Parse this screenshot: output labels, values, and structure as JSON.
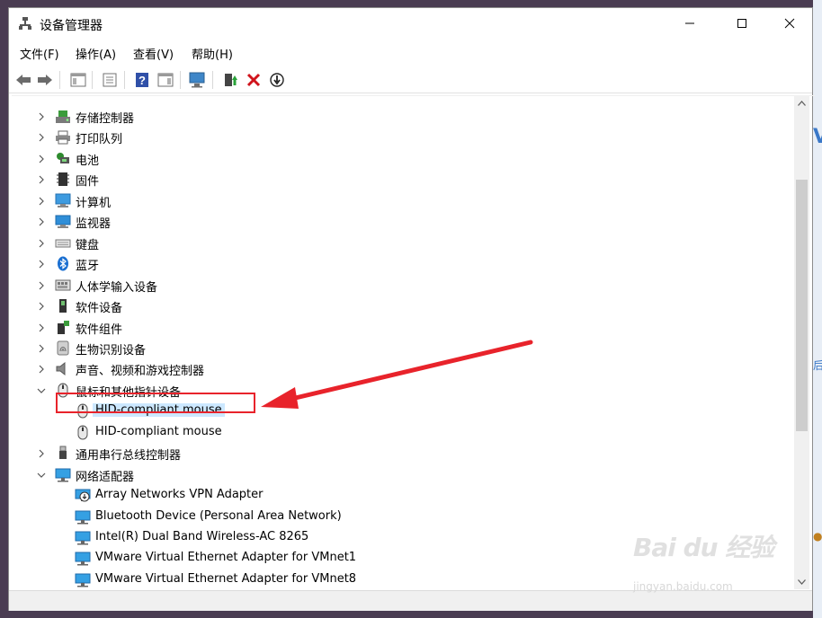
{
  "window": {
    "title": "设备管理器",
    "controls": {
      "minimize": "minimize",
      "maximize": "maximize",
      "close": "close"
    }
  },
  "menu": [
    {
      "label": "文件(F)"
    },
    {
      "label": "操作(A)"
    },
    {
      "label": "查看(V)"
    },
    {
      "label": "帮助(H)"
    }
  ],
  "toolbar": {
    "icons": [
      "back-arrow-icon",
      "forward-arrow-icon",
      "show-hide-console-tree-icon",
      "properties-icon",
      "help-icon",
      "action-pane-icon",
      "monitor-scan-icon",
      "update-driver-icon",
      "uninstall-x-icon",
      "disable-device-icon"
    ]
  },
  "tree": [
    {
      "label": "存储控制器",
      "level": 1,
      "expanded": false,
      "icon": "storage-controller-icon"
    },
    {
      "label": "打印队列",
      "level": 1,
      "expanded": false,
      "icon": "printer-icon"
    },
    {
      "label": "电池",
      "level": 1,
      "expanded": false,
      "icon": "battery-icon"
    },
    {
      "label": "固件",
      "level": 1,
      "expanded": false,
      "icon": "firmware-icon"
    },
    {
      "label": "计算机",
      "level": 1,
      "expanded": false,
      "icon": "computer-icon"
    },
    {
      "label": "监视器",
      "level": 1,
      "expanded": false,
      "icon": "monitor-icon"
    },
    {
      "label": "键盘",
      "level": 1,
      "expanded": false,
      "icon": "keyboard-icon"
    },
    {
      "label": "蓝牙",
      "level": 1,
      "expanded": false,
      "icon": "bluetooth-icon"
    },
    {
      "label": "人体学输入设备",
      "level": 1,
      "expanded": false,
      "icon": "hid-icon"
    },
    {
      "label": "软件设备",
      "level": 1,
      "expanded": false,
      "icon": "software-device-icon"
    },
    {
      "label": "软件组件",
      "level": 1,
      "expanded": false,
      "icon": "software-component-icon"
    },
    {
      "label": "生物识别设备",
      "level": 1,
      "expanded": false,
      "icon": "biometric-icon"
    },
    {
      "label": "声音、视频和游戏控制器",
      "level": 1,
      "expanded": false,
      "icon": "speaker-icon"
    },
    {
      "label": "鼠标和其他指针设备",
      "level": 1,
      "expanded": true,
      "icon": "mouse-icon"
    },
    {
      "label": "HID-compliant mouse",
      "level": 2,
      "selected": true,
      "icon": "mouse-icon"
    },
    {
      "label": "HID-compliant mouse",
      "level": 2,
      "selected": false,
      "icon": "mouse-icon"
    },
    {
      "label": "通用串行总线控制器",
      "level": 1,
      "expanded": false,
      "icon": "usb-icon"
    },
    {
      "label": "网络适配器",
      "level": 1,
      "expanded": true,
      "icon": "network-adapter-icon"
    },
    {
      "label": "Array Networks VPN Adapter",
      "level": 2,
      "icon": "network-adapter-warning-icon"
    },
    {
      "label": "Bluetooth Device (Personal Area Network)",
      "level": 2,
      "icon": "network-adapter-icon"
    },
    {
      "label": "Intel(R) Dual Band Wireless-AC 8265",
      "level": 2,
      "icon": "network-adapter-icon"
    },
    {
      "label": "VMware Virtual Ethernet Adapter for VMnet1",
      "level": 2,
      "icon": "network-adapter-icon"
    },
    {
      "label": "VMware Virtual Ethernet Adapter for VMnet8",
      "level": 2,
      "icon": "network-adapter-icon"
    }
  ],
  "annotation": {
    "color": "#e8232b"
  },
  "watermark": {
    "logo": "Bai du 经验",
    "url": "jingyan.baidu.com"
  },
  "colors": {
    "selection": "#cce8ff",
    "accent_blue": "#1e73be"
  }
}
